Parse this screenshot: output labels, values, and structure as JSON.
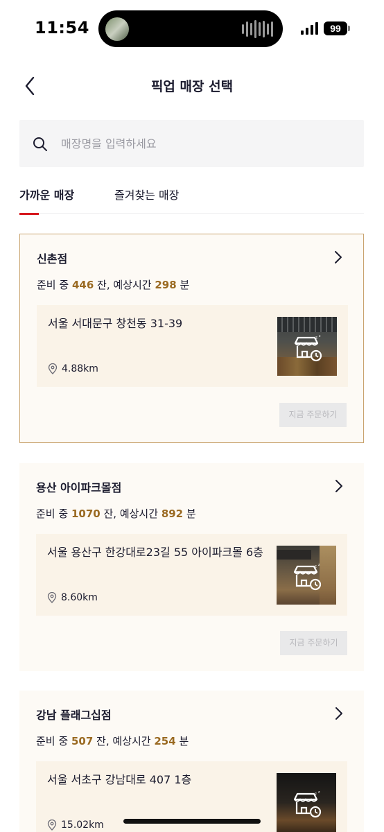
{
  "status_bar": {
    "time": "11:54",
    "battery": "99"
  },
  "header": {
    "title": "픽업 매장 선택"
  },
  "search": {
    "placeholder": "매장명을 입력하세요",
    "value": ""
  },
  "tabs": [
    {
      "label": "가까운 매장",
      "active": true
    },
    {
      "label": "즐겨찾는 매장",
      "active": false
    }
  ],
  "stores": [
    {
      "name": "신촌점",
      "status_prefix": "준비 중",
      "preparing_count": "446",
      "status_mid": "잔, 예상시간",
      "wait_minutes": "298",
      "status_suffix": "분",
      "address": "서울 서대문구 창천동 31-39",
      "distance": "4.88km",
      "order_label": "지금 주문하기",
      "selected": true
    },
    {
      "name": "용산 아이파크몰점",
      "status_prefix": "준비 중",
      "preparing_count": "1070",
      "status_mid": "잔, 예상시간",
      "wait_minutes": "892",
      "status_suffix": "분",
      "address": "서울 용산구 한강대로23길 55 아이파크몰 6층",
      "distance": "8.60km",
      "order_label": "지금 주문하기",
      "selected": false
    },
    {
      "name": "강남 플래그십점",
      "status_prefix": "준비 중",
      "preparing_count": "507",
      "status_mid": "잔, 예상시간",
      "wait_minutes": "254",
      "status_suffix": "분",
      "address": "서울 서초구 강남대로 407 1층",
      "distance": "15.02km",
      "selected": false
    }
  ],
  "colors": {
    "accent_red": "#d6171d",
    "highlight_number": "#9a6a22",
    "card_background": "#fdfaf5",
    "selected_border": "#c9a36e"
  }
}
